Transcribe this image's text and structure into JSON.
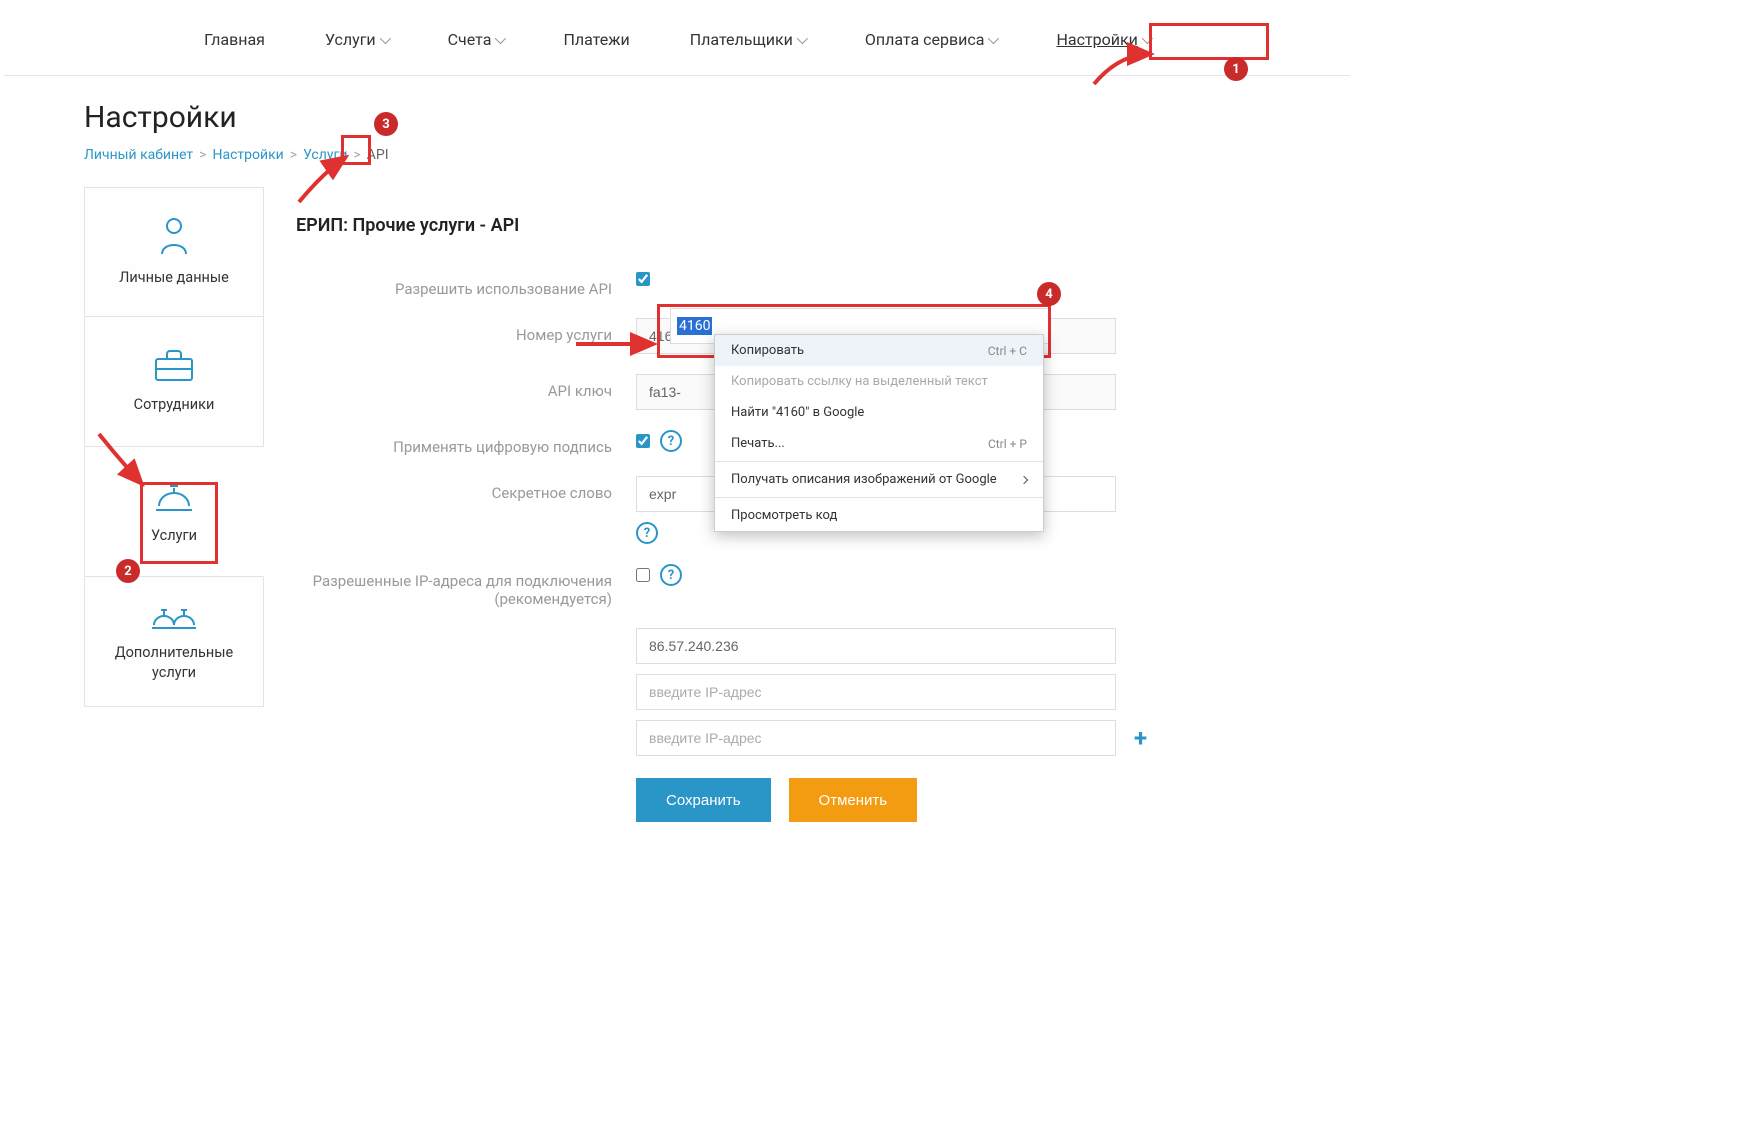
{
  "nav": {
    "items": [
      {
        "label": "Главная",
        "dropdown": false
      },
      {
        "label": "Услуги",
        "dropdown": true
      },
      {
        "label": "Счета",
        "dropdown": true
      },
      {
        "label": "Платежи",
        "dropdown": false
      },
      {
        "label": "Плательщики",
        "dropdown": true
      },
      {
        "label": "Оплата сервиса",
        "dropdown": true
      },
      {
        "label": "Настройки",
        "dropdown": true,
        "active": true
      }
    ]
  },
  "page_title": "Настройки",
  "breadcrumb": {
    "items": [
      "Личный кабинет",
      "Настройки",
      "Услуги"
    ],
    "current": "API"
  },
  "sidebar": {
    "items": [
      {
        "label": "Личные данные"
      },
      {
        "label": "Сотрудники"
      },
      {
        "label": "Услуги",
        "active": true
      },
      {
        "label": "Дополнительные услуги"
      }
    ]
  },
  "panel": {
    "title": "ЕРИП: Прочие услуги - API",
    "fields": {
      "allow_api_label": "Разрешить использование API",
      "service_number_label": "Номер услуги",
      "service_number_value": "4160",
      "api_key_label": "API ключ",
      "api_key_value": "fa13-",
      "digital_sig_label": "Применять цифровую подпись",
      "secret_word_label": "Секретное слово",
      "secret_word_value": "expr",
      "allowed_ips_label": "Разрешенные IP-адреса для подключения (рекомендуется)",
      "ip1_value": "86.57.240.236",
      "ip_placeholder": "введите IP-адрес"
    },
    "buttons": {
      "save": "Сохранить",
      "cancel": "Отменить"
    }
  },
  "context_menu": {
    "copy": "Копировать",
    "copy_sc": "Ctrl + C",
    "copy_link": "Копировать ссылку на выделенный текст",
    "search": "Найти \"4160\" в Google",
    "print": "Печать...",
    "print_sc": "Ctrl + P",
    "img_desc": "Получать описания изображений от Google",
    "inspect": "Просмотреть код"
  },
  "annotations": {
    "1": "1",
    "2": "2",
    "3": "3",
    "4": "4"
  }
}
